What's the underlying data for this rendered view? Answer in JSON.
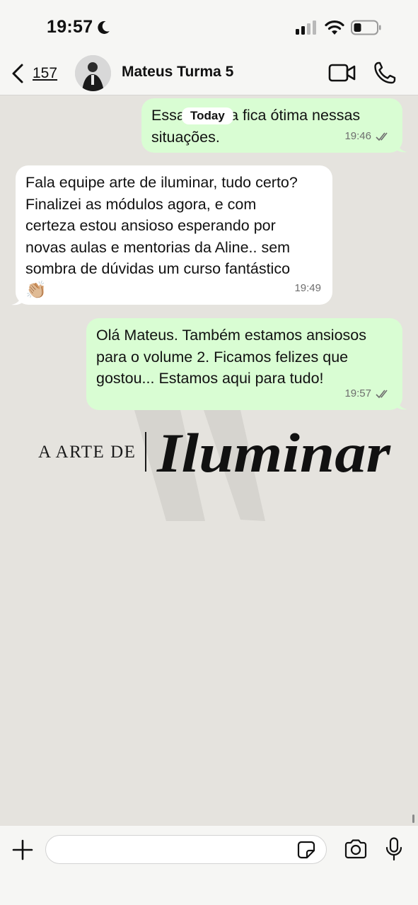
{
  "status_bar": {
    "time": "19:57"
  },
  "header": {
    "back_count": "157",
    "contact_name": "Mateus Turma 5"
  },
  "chat": {
    "date_label": "Today",
    "messages": [
      {
        "direction": "outgoing",
        "lines": [
          "Essa história fica ótima nessas",
          "situações."
        ],
        "time": "19:46",
        "status": "read"
      },
      {
        "direction": "incoming",
        "lines": [
          "Fala equipe arte de iluminar, tudo certo?",
          "Finalizei as módulos agora, e com",
          "certeza estou ansioso esperando por",
          "novas aulas e mentorias da Aline.. sem",
          "sombra de dúvidas um curso fantástico"
        ],
        "emoji": "👏🏼",
        "time": "19:49"
      },
      {
        "direction": "outgoing",
        "lines": [
          "Olá Mateus. Também estamos ansiosos",
          "para o volume 2. Ficamos felizes que",
          "gostou... Estamos aqui para tudo!"
        ],
        "time": "19:57",
        "status": "read"
      }
    ]
  },
  "logo": {
    "prefix": "A ARTE DE",
    "wordmark": "Iluminar"
  },
  "composer": {
    "input_value": "",
    "input_placeholder": ""
  },
  "colors": {
    "outgoing_bubble": "#d9fdd3",
    "incoming_bubble": "#ffffff",
    "chat_background": "#e5e3de",
    "read_checks": "#6e6e6e"
  },
  "icons": {
    "status": [
      "moon-icon",
      "signal-icon",
      "wifi-icon",
      "battery-icon"
    ],
    "header": [
      "back-chevron-icon",
      "video-call-icon",
      "phone-call-icon"
    ],
    "composer": [
      "plus-icon",
      "sticker-icon",
      "camera-icon",
      "microphone-icon"
    ],
    "message": [
      "double-check-icon"
    ]
  }
}
